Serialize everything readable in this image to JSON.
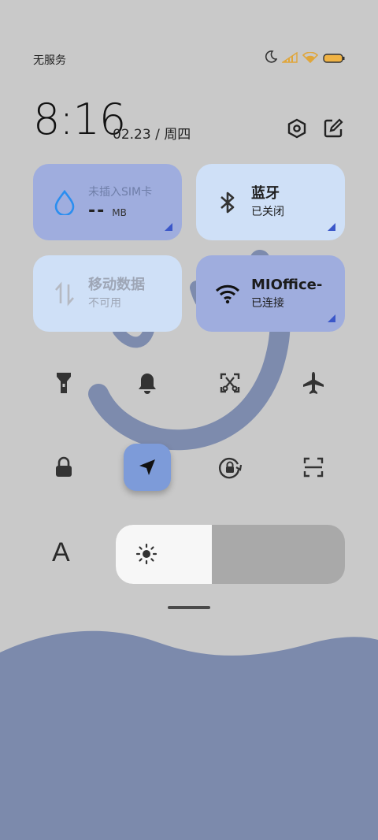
{
  "status_bar": {
    "carrier": "无服务",
    "icons": [
      "moon-icon",
      "signal-icon",
      "wifi-icon",
      "battery-icon"
    ],
    "battery_color": "#f0b345"
  },
  "header": {
    "time": "8:16",
    "date": "02.23 / 周四",
    "icons": [
      "settings-icon",
      "edit-icon"
    ]
  },
  "tiles": {
    "data_usage": {
      "label": "未插入SIM卡",
      "value": "--",
      "unit": "MB",
      "icon": "water-drop-icon"
    },
    "bluetooth": {
      "title": "蓝牙",
      "status": "已关闭",
      "icon": "bluetooth-icon"
    },
    "mobile_data": {
      "title": "移动数据",
      "status": "不可用",
      "icon": "mobile-data-icon"
    },
    "wifi": {
      "title": "MIOffice-",
      "status": "已连接",
      "icon": "wifi-icon"
    }
  },
  "toggles": [
    {
      "name": "flashlight-icon",
      "active": false
    },
    {
      "name": "bell-icon",
      "active": false
    },
    {
      "name": "screenshot-icon",
      "active": false
    },
    {
      "name": "airplane-icon",
      "active": false
    },
    {
      "name": "lock-icon",
      "active": false
    },
    {
      "name": "location-icon",
      "active": true
    },
    {
      "name": "rotation-lock-icon",
      "active": false
    },
    {
      "name": "scan-icon",
      "active": false
    }
  ],
  "brightness": {
    "font_label": "A",
    "level": 0.42,
    "icon": "sun-icon"
  },
  "colors": {
    "background": "#c9c9c9",
    "tile_active": "#9fadde",
    "tile_inactive": "#cfe0f7",
    "accent": "#3b57c9",
    "wave": "#7c8aac",
    "location_active": "#7d9bd9"
  }
}
